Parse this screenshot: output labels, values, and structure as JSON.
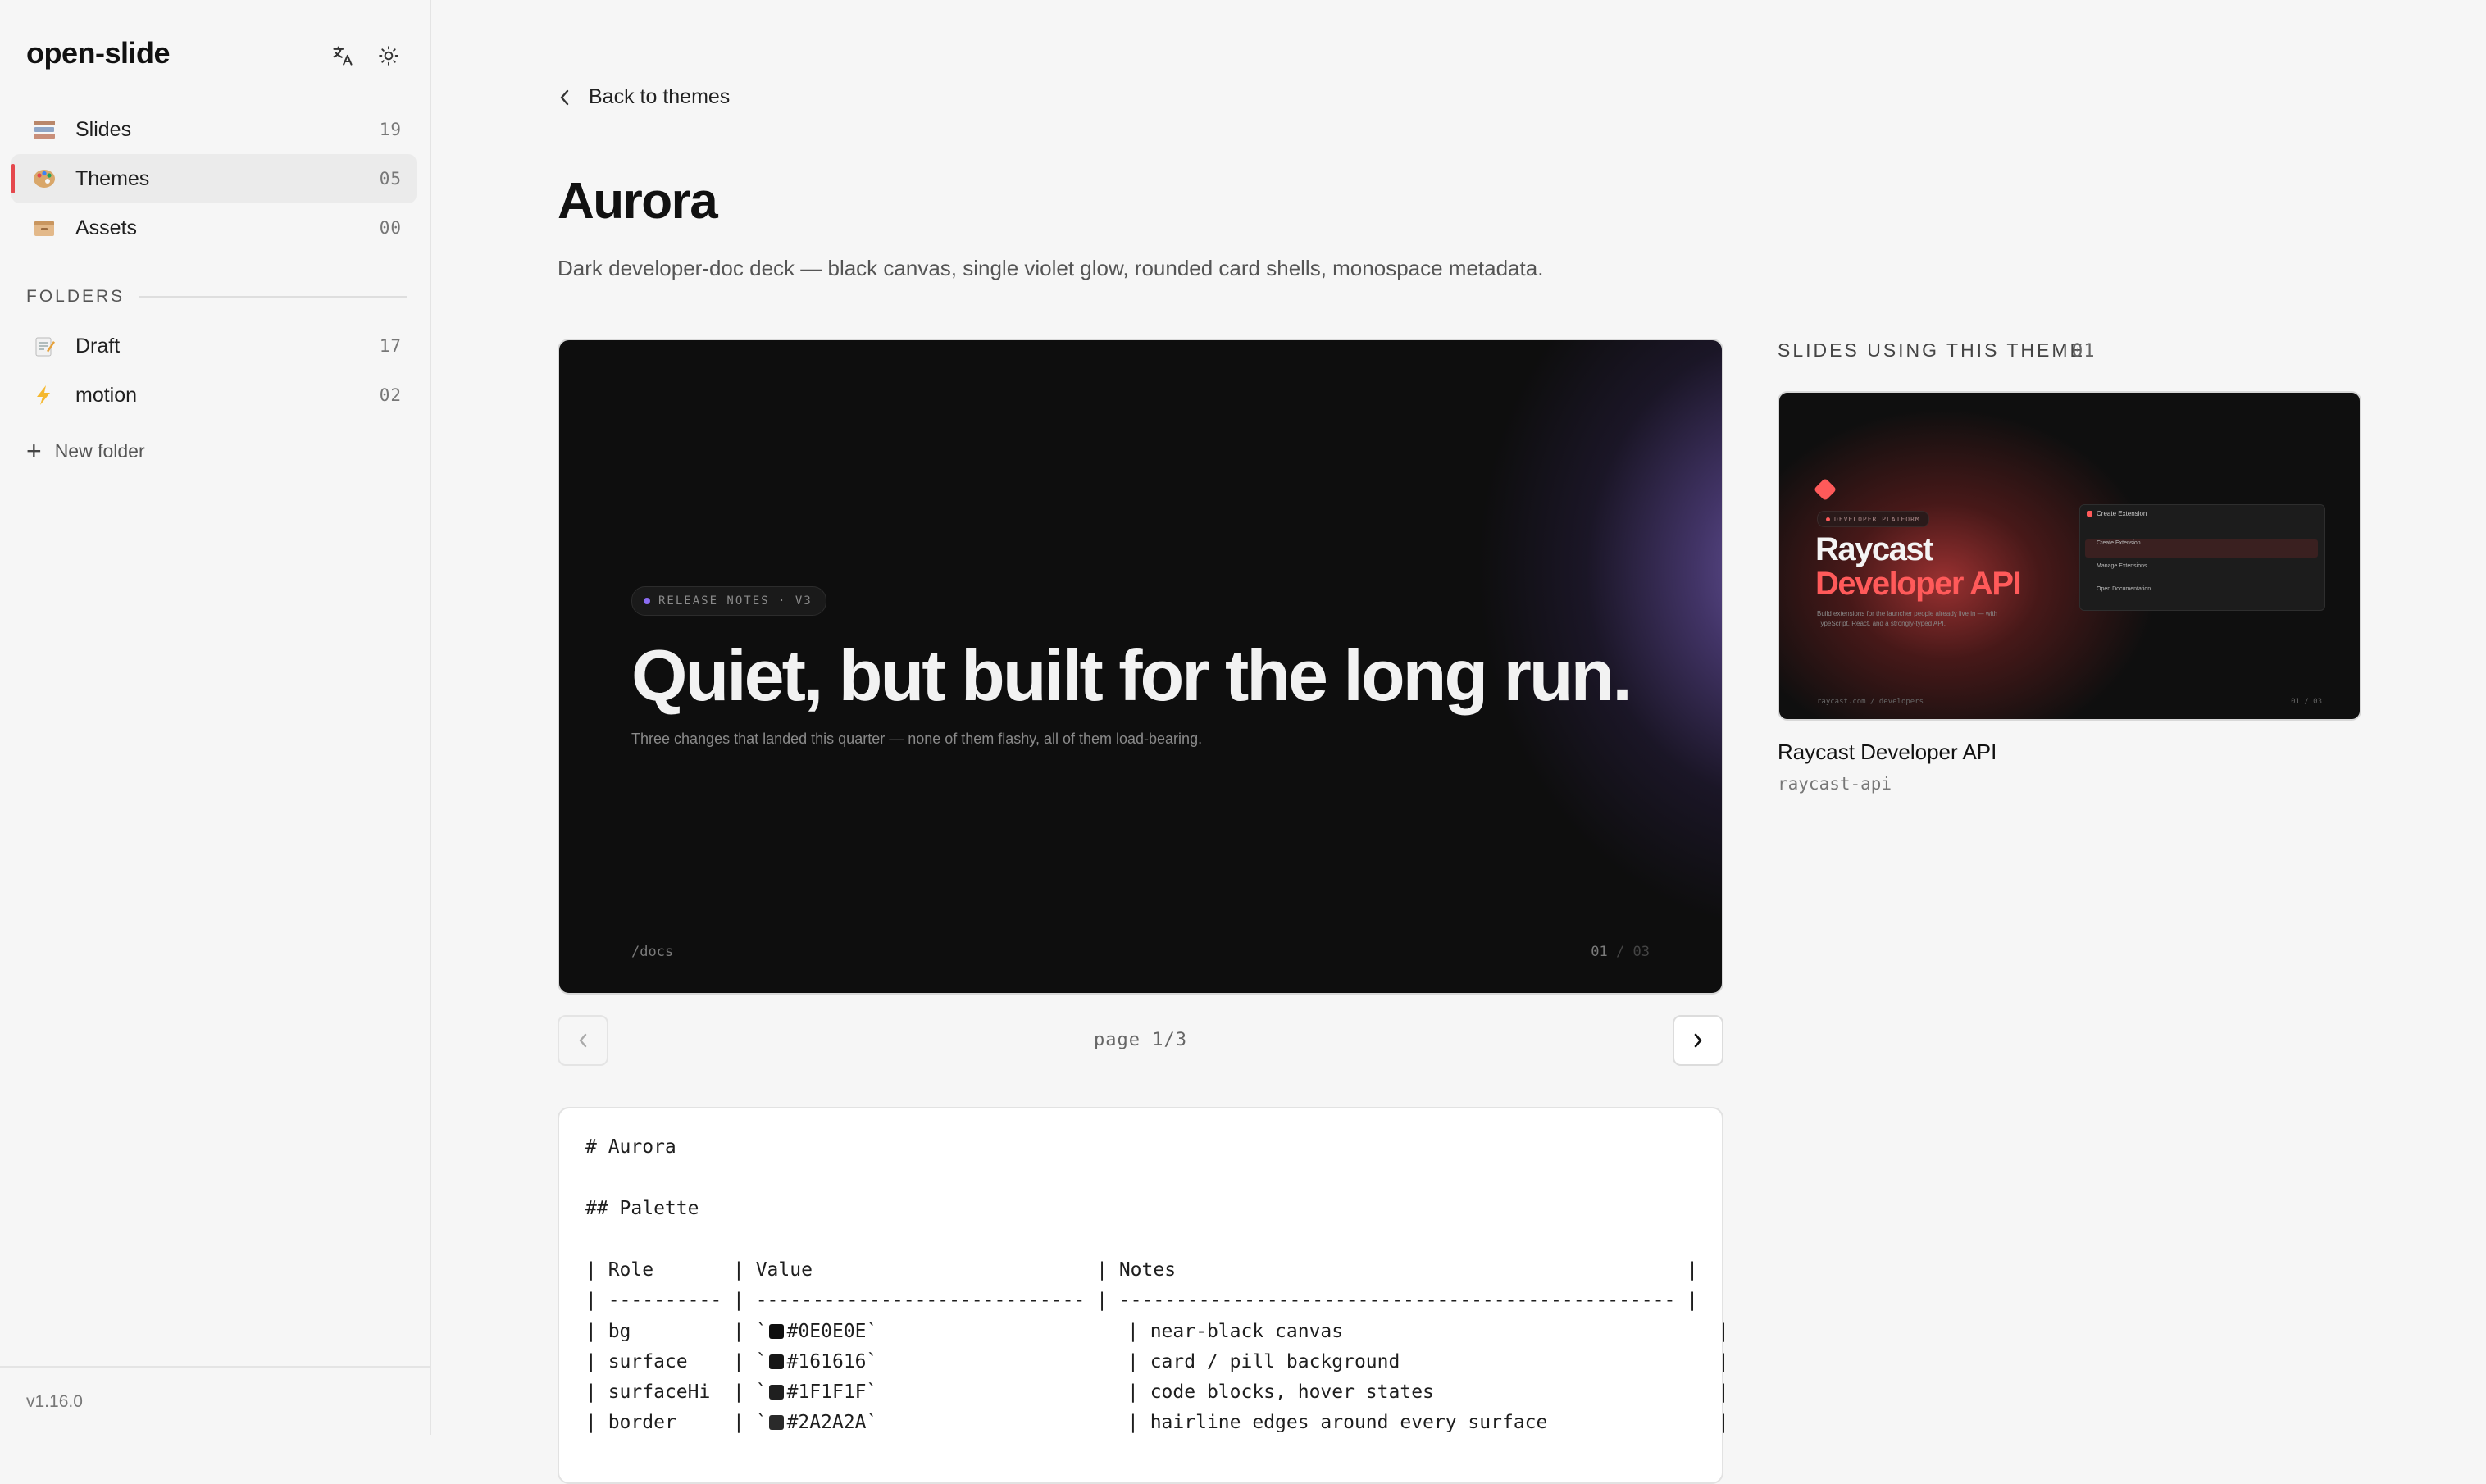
{
  "app": {
    "name": "open-slide",
    "version": "v1.16.0"
  },
  "sidebar": {
    "nav": [
      {
        "label": "Slides",
        "count": "19",
        "icon": "books-emoji"
      },
      {
        "label": "Themes",
        "count": "05",
        "icon": "palette-emoji",
        "active": true
      },
      {
        "label": "Assets",
        "count": "00",
        "icon": "card-box-emoji"
      }
    ],
    "folders_heading": "FOLDERS",
    "folders": [
      {
        "label": "Draft",
        "count": "17",
        "icon": "memo-emoji"
      },
      {
        "label": "motion",
        "count": "02",
        "icon": "lightning-emoji"
      }
    ],
    "new_folder_label": "New folder"
  },
  "main": {
    "back_label": "Back to themes",
    "title": "Aurora",
    "description": "Dark developer-doc deck — black canvas, single violet glow, rounded card shells, monospace metadata.",
    "preview": {
      "pill": "RELEASE NOTES · V3",
      "heading": "Quiet, but built for the long run.",
      "subheading": "Three changes that landed this quarter — none of them flashy, all of them load-bearing.",
      "footer_path": "/docs",
      "page_current": "01",
      "page_sep": "/",
      "page_total": "03"
    },
    "pager_label": "page 1/3",
    "markdown_lines": [
      "# Aurora",
      "## Palette",
      "| Role       | Value                         | Notes                                             |",
      "| ---------- | ----------------------------- | ------------------------------------------------- |",
      "| bg         | `",
      "| surface    | `",
      "| surfaceHi  | `",
      "| border     | `"
    ],
    "palette_rows": [
      {
        "role": "bg",
        "value": "#0E0E0E",
        "note": "near-black canvas"
      },
      {
        "role": "surface",
        "value": "#161616",
        "note": "card / pill background"
      },
      {
        "role": "surfaceHi",
        "value": "#1F1F1F",
        "note": "code blocks, hover states"
      },
      {
        "role": "border",
        "value": "#2A2A2A",
        "note": "hairline edges around every surface"
      }
    ]
  },
  "using": {
    "heading": "SLIDES USING THIS THEME",
    "count": "01",
    "slides": [
      {
        "name": "Raycast Developer API",
        "id": "raycast-api",
        "thumb": {
          "pill": "DEVELOPER PLATFORM",
          "line1": "Raycast",
          "line2": "Developer API",
          "body": "Build extensions for the launcher people already live in — with TypeScript, React, and a strongly-typed API.",
          "footer_left": "raycast.com / developers",
          "footer_right": "01 / 03",
          "panel_title": "Create Extension",
          "panel_rows": [
            "Create Extension",
            "Manage Extensions",
            "Open Documentation"
          ]
        }
      }
    ]
  },
  "colors": {
    "accent_active": "#e5484d",
    "preview_bg": "#0e0e0e",
    "violet_glow": "#705caa",
    "raycast_red": "#ff5a5a"
  }
}
